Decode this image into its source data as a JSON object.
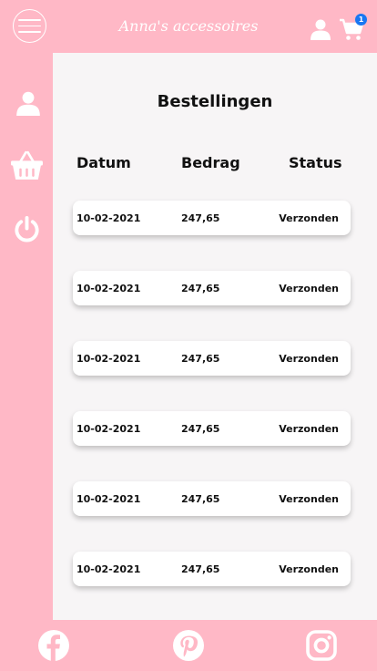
{
  "header": {
    "title": "Anna's accessoires",
    "cart_count": "1",
    "icons": [
      "menu-icon",
      "user-icon",
      "cart-icon"
    ]
  },
  "sidebar": {
    "icons": [
      "user-icon",
      "basket-icon",
      "power-icon"
    ]
  },
  "main": {
    "title": "Bestellingen",
    "columns": [
      "Datum",
      "Bedrag",
      "Status"
    ],
    "orders": [
      {
        "date": "10-02-2021",
        "amount": "247,65",
        "status": "Verzonden"
      },
      {
        "date": "10-02-2021",
        "amount": "247,65",
        "status": "Verzonden"
      },
      {
        "date": "10-02-2021",
        "amount": "247,65",
        "status": "Verzonden"
      },
      {
        "date": "10-02-2021",
        "amount": "247,65",
        "status": "Verzonden"
      },
      {
        "date": "10-02-2021",
        "amount": "247,65",
        "status": "Verzonden"
      },
      {
        "date": "10-02-2021",
        "amount": "247,65",
        "status": "Verzonden"
      }
    ]
  },
  "footer": {
    "icons": [
      "facebook-icon",
      "pinterest-icon",
      "instagram-icon"
    ]
  },
  "colors": {
    "brand_pink": "#ffb8c6",
    "background": "#f7f5f6",
    "badge": "#1877f2"
  }
}
